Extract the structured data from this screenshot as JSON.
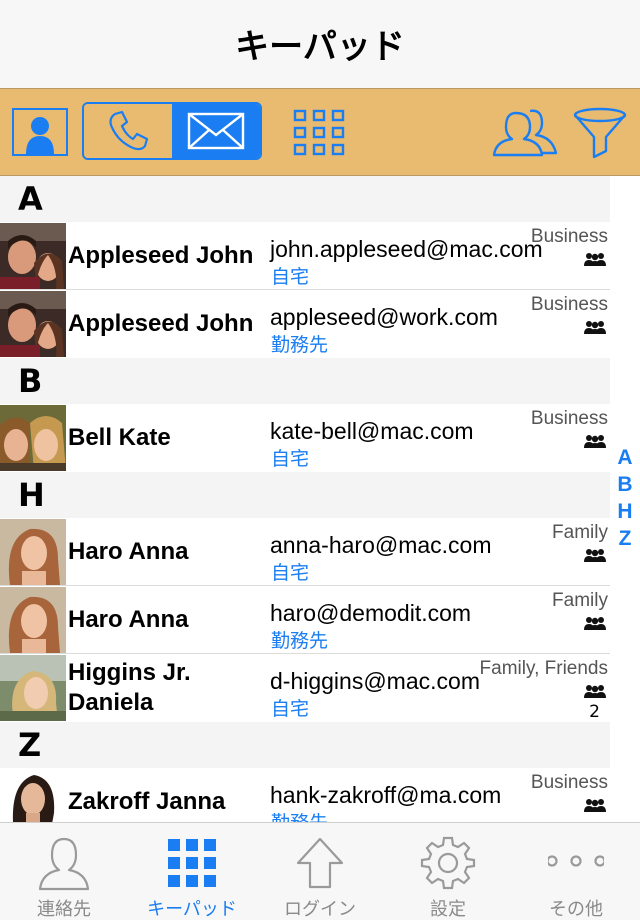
{
  "nav": {
    "title": "キーパッド"
  },
  "toolbar": {
    "icons": [
      "contact-card-icon",
      "phone-icon",
      "envelope-icon",
      "grid-icon",
      "groups-icon",
      "filter-icon"
    ],
    "accent": "#1a7ef2",
    "background": "#e8bb70"
  },
  "sections": [
    {
      "letter": "A"
    },
    {
      "letter": "B"
    },
    {
      "letter": "H"
    },
    {
      "letter": "Z"
    }
  ],
  "contacts": [
    {
      "name": "Appleseed John",
      "email": "john.appleseed@mac.com",
      "email_type": "自宅",
      "group": "Business",
      "count": ""
    },
    {
      "name": "Appleseed John",
      "email": "appleseed@work.com",
      "email_type": "勤務先",
      "group": "Business",
      "count": ""
    },
    {
      "name": "Bell Kate",
      "email": "kate-bell@mac.com",
      "email_type": "自宅",
      "group": "Business",
      "count": ""
    },
    {
      "name": "Haro Anna",
      "email": "anna-haro@mac.com",
      "email_type": "自宅",
      "group": "Family",
      "count": ""
    },
    {
      "name": "Haro Anna",
      "email": "haro@demodit.com",
      "email_type": "勤務先",
      "group": "Family",
      "count": ""
    },
    {
      "name": "Higgins Jr. Daniela",
      "email": "d-higgins@mac.com",
      "email_type": "自宅",
      "group": "Family, Friends",
      "count": "2"
    },
    {
      "name": "Zakroff Janna",
      "email": "hank-zakroff@ma.com",
      "email_type": "勤務先",
      "group": "Business",
      "count": ""
    }
  ],
  "index": [
    "A",
    "B",
    "H",
    "Z"
  ],
  "tabs": [
    {
      "label": "連絡先",
      "icon": "person-icon"
    },
    {
      "label": "キーパッド",
      "icon": "keypad-icon"
    },
    {
      "label": "ログイン",
      "icon": "upload-arrow-icon"
    },
    {
      "label": "設定",
      "icon": "gear-icon"
    },
    {
      "label": "その他",
      "icon": "more-icon"
    }
  ]
}
